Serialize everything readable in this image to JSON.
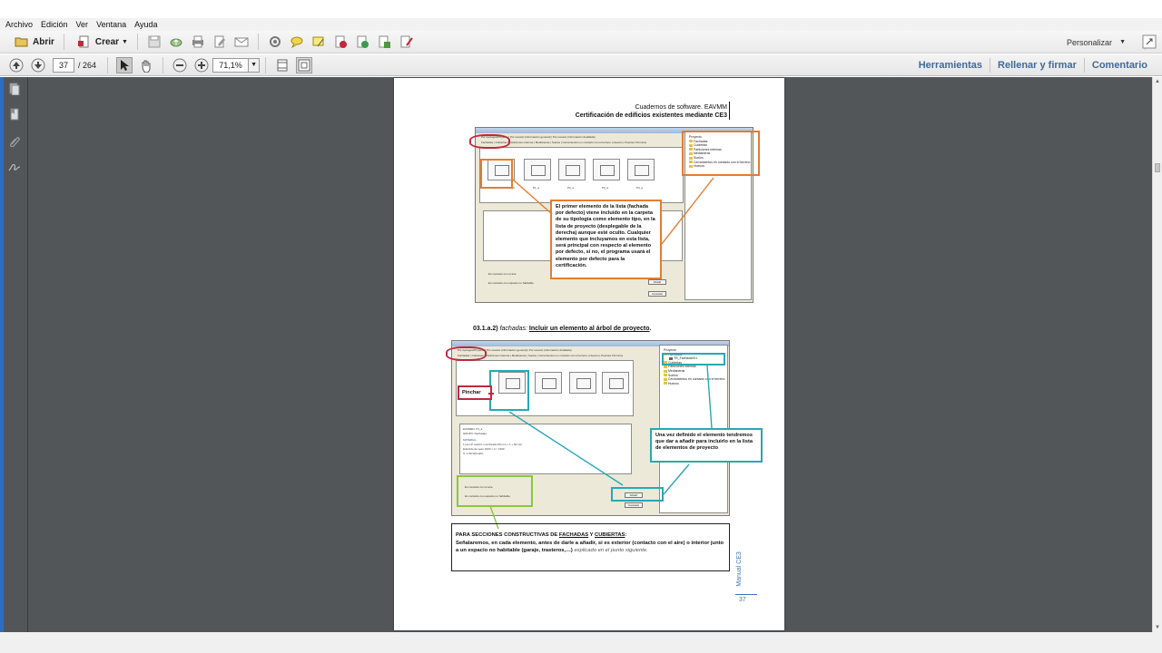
{
  "menu": [
    "Archivo",
    "Edición",
    "Ver",
    "Ventana",
    "Ayuda"
  ],
  "toolbar": {
    "open_label": "Abrir",
    "create_label": "Crear",
    "customize_label": "Personalizar"
  },
  "nav": {
    "current_page": "37",
    "total_pages": "/ 264",
    "zoom": "71,1%"
  },
  "panel_links": [
    "Herramientas",
    "Rellenar y firmar",
    "Comentario"
  ],
  "document": {
    "header_line1": "Cuadernos de software. EAVMM",
    "header_line2": "Certificación de edificios existentes mediante CE3",
    "callout1": "El primer elemento de la lista (fachada por defecto) viene incluido en la carpeta de su tipología como elemento tipo, en la lista de proyecto (desplegable de la derecha) aunque esté oculto. Cualquier elemento que incluyamos en esta lista, será principal con respecto al elemento por defecto, si no, el programa usará el elemento por defecto para la certificación.",
    "caption_number": "03.1.a.2)",
    "caption_italic": "fachadas:",
    "caption_underlined": "Incluir un elemento al árbol de proyecto",
    "callout_pinchar": "Pinchar",
    "callout2": "Una vez definido el elemento tendremos que dar a añadir para incluirlo en la lista de elementos de proyecto",
    "note_prefix": "PARA SECCIONES CONSTRUCTIVAS DE ",
    "note_fachadas": "FACHADAS",
    "note_y": " Y ",
    "note_cubiertas": "CUBIERTAS",
    "note_body": "Señalaremos, en cada elemento, antes de darle a añadir, si es exterior (contacto con el aire) o interior junto a un espacio no habitable (garaje, trasteros,…)",
    "note_italic": "explicado en el punto siguiente.",
    "footer_label": "Manual CE3",
    "page_number": "37"
  },
  "screenshot1": {
    "tabs": "Por tipología/Proyecto | Por usuario (información general) | Por usuario (información detallada)",
    "subtabs": "Fachadas | Cubiertas | Particiones internas | Medianeras | Suelos | Cerramientos en contacto con el terreno | Huecos | Puentes Térmicos",
    "thumb_labels": [
      "Fachada por defecto B_0",
      "P1_a",
      "P2_a",
      "P3_a",
      "P4_a"
    ],
    "tree": [
      "Proyecto",
      "Fachadas",
      "Cubiertas",
      "Particiones internas",
      "Medianeras",
      "Suelos",
      "Cerramientos en contacto con el terreno",
      "Huecos"
    ],
    "radio1": "En contacto con el aire",
    "radio2": "En contacto con espacio no habitable",
    "btn_add": "Añadir",
    "btn_cancel": "Cancelar"
  },
  "screenshot2": {
    "tree": [
      "Proyecto",
      "Fachadas",
      "TR_Fachada001",
      "Cubiertas",
      "Particiones internas",
      "Medianeras",
      "Suelos",
      "Cerramientos en contacto con el terreno",
      "Huecos"
    ],
    "info_lines": [
      "EXAMEN: P1_a",
      "GRUPO: Fachadas",
      "MATERIAL",
      "1 pie LP macizo o perforado 50 mm + 1 + 50 mm",
      "Enlucido de yeso 1000 < d < 1300",
      "U: 1.59 W/(m2K)"
    ],
    "radio1": "En contacto con el aire",
    "radio2": "En contacto con espacio no habitable",
    "btn_add": "Añadir",
    "btn_cancel": "Cancelar"
  },
  "colors": {
    "orange": "#e57c30",
    "teal": "#27a8b8",
    "red": "#c0283c",
    "green": "#8cc63f",
    "link_blue": "#3f6a9a",
    "doc_bg": "#525659"
  }
}
